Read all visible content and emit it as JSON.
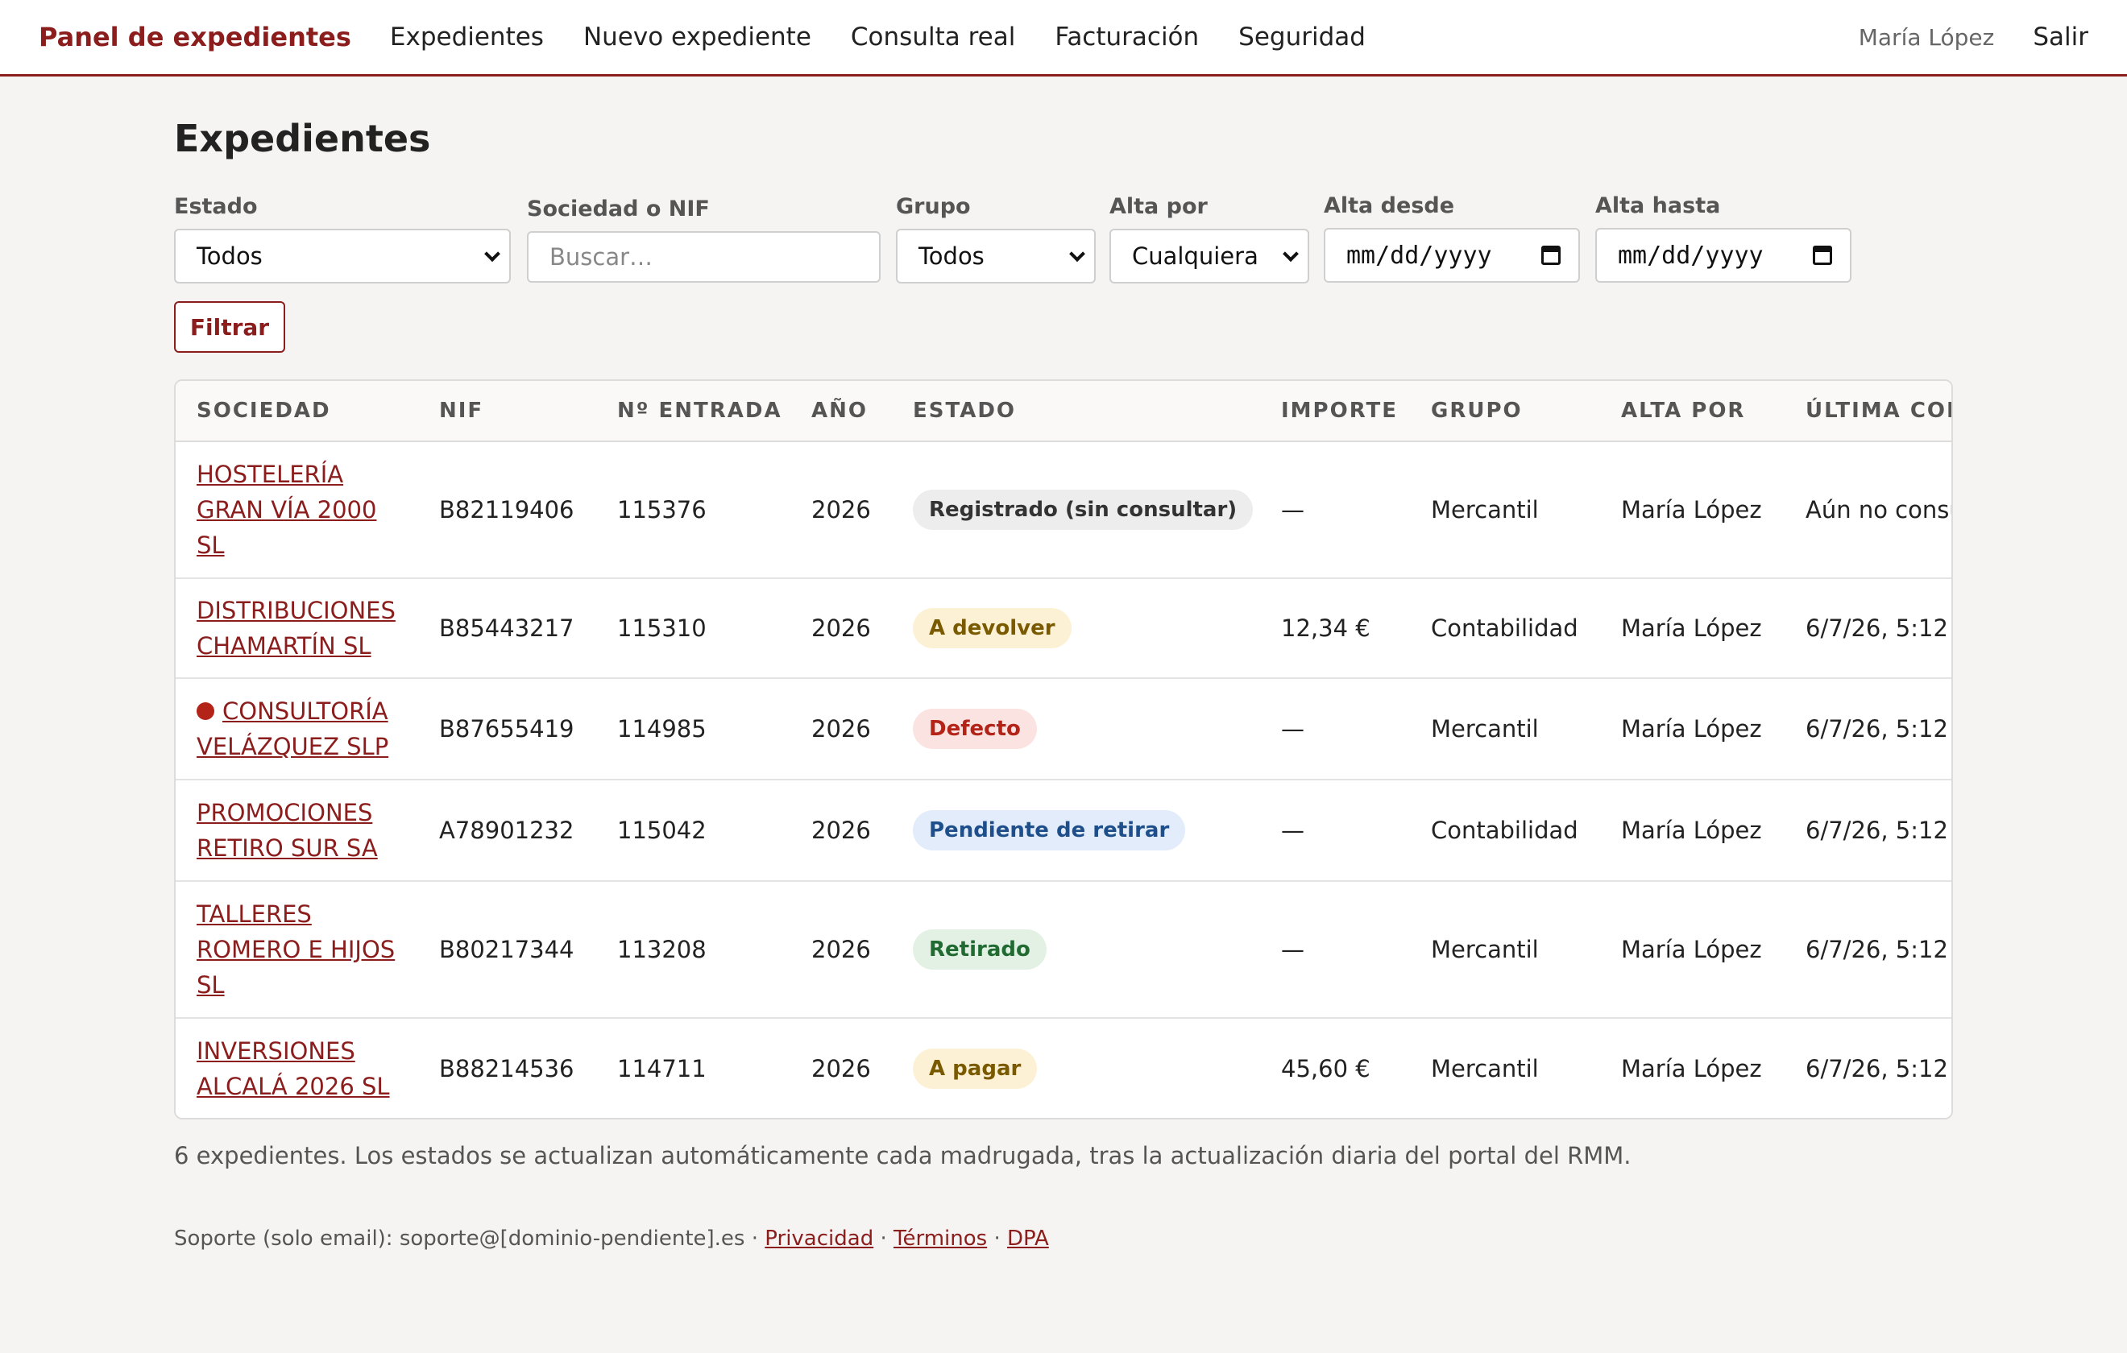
{
  "nav": {
    "brand": "Panel de expedientes",
    "links": [
      "Expedientes",
      "Nuevo expediente",
      "Consulta real",
      "Facturación",
      "Seguridad"
    ],
    "user": "María López",
    "logout": "Salir"
  },
  "page": {
    "title": "Expedientes"
  },
  "filters": {
    "estado": {
      "label": "Estado",
      "value": "Todos"
    },
    "sociedad": {
      "label": "Sociedad o NIF",
      "placeholder": "Buscar…"
    },
    "grupo": {
      "label": "Grupo",
      "value": "Todos"
    },
    "alta_por": {
      "label": "Alta por",
      "value": "Cualquiera"
    },
    "alta_desde": {
      "label": "Alta desde",
      "placeholder": "mm/dd/yyyy"
    },
    "alta_hasta": {
      "label": "Alta hasta",
      "placeholder": "mm/dd/yyyy"
    },
    "button": "Filtrar"
  },
  "table": {
    "headers": [
      "SOCIEDAD",
      "NIF",
      "Nº ENTRADA",
      "AÑO",
      "ESTADO",
      "IMPORTE",
      "GRUPO",
      "ALTA POR",
      "ÚLTIMA CONSULTA"
    ],
    "rows": [
      {
        "sociedad": "HOSTELERÍA GRAN VÍA 2000 SL",
        "alert": false,
        "nif": "B82119406",
        "entrada": "115376",
        "anio": "2026",
        "estado": "Registrado (sin consultar)",
        "estado_tone": "neutral",
        "importe": "—",
        "grupo": "Mercantil",
        "alta_por": "María López",
        "ultima": "Aún no consultado"
      },
      {
        "sociedad": "DISTRIBUCIONES CHAMARTÍN SL",
        "alert": false,
        "nif": "B85443217",
        "entrada": "115310",
        "anio": "2026",
        "estado": "A devolver",
        "estado_tone": "warning",
        "importe": "12,34 €",
        "grupo": "Contabilidad",
        "alta_por": "María López",
        "ultima": "6/7/26, 5:12"
      },
      {
        "sociedad": "CONSULTORÍA VELÁZQUEZ SLP",
        "alert": true,
        "nif": "B87655419",
        "entrada": "114985",
        "anio": "2026",
        "estado": "Defecto",
        "estado_tone": "danger",
        "importe": "—",
        "grupo": "Mercantil",
        "alta_por": "María López",
        "ultima": "6/7/26, 5:12"
      },
      {
        "sociedad": "PROMOCIONES RETIRO SUR SA",
        "alert": false,
        "nif": "A78901232",
        "entrada": "115042",
        "anio": "2026",
        "estado": "Pendiente de retirar",
        "estado_tone": "info",
        "importe": "—",
        "grupo": "Contabilidad",
        "alta_por": "María López",
        "ultima": "6/7/26, 5:12"
      },
      {
        "sociedad": "TALLERES ROMERO E HIJOS SL",
        "alert": false,
        "nif": "B80217344",
        "entrada": "113208",
        "anio": "2026",
        "estado": "Retirado",
        "estado_tone": "success",
        "importe": "—",
        "grupo": "Mercantil",
        "alta_por": "María López",
        "ultima": "6/7/26, 5:12"
      },
      {
        "sociedad": "INVERSIONES ALCALÁ 2026 SL",
        "alert": false,
        "nif": "B88214536",
        "entrada": "114711",
        "anio": "2026",
        "estado": "A pagar",
        "estado_tone": "warning",
        "importe": "45,60 €",
        "grupo": "Mercantil",
        "alta_por": "María López",
        "ultima": "6/7/26, 5:12"
      }
    ]
  },
  "summary": "6 expedientes. Los estados se actualizan automáticamente cada madrugada, tras la actualización diaria del portal del RMM.",
  "footer": {
    "support": "Soporte (solo email): soporte@[dominio-pendiente].es",
    "links": [
      "Privacidad",
      "Términos",
      "DPA"
    ]
  },
  "colors": {
    "accent": "#8b1d1d",
    "badge_neutral": "#ededed",
    "badge_warning": "#fcf1d4",
    "badge_danger": "#fbe3e1",
    "badge_info": "#e2ecfb",
    "badge_success": "#e3f1e5"
  }
}
